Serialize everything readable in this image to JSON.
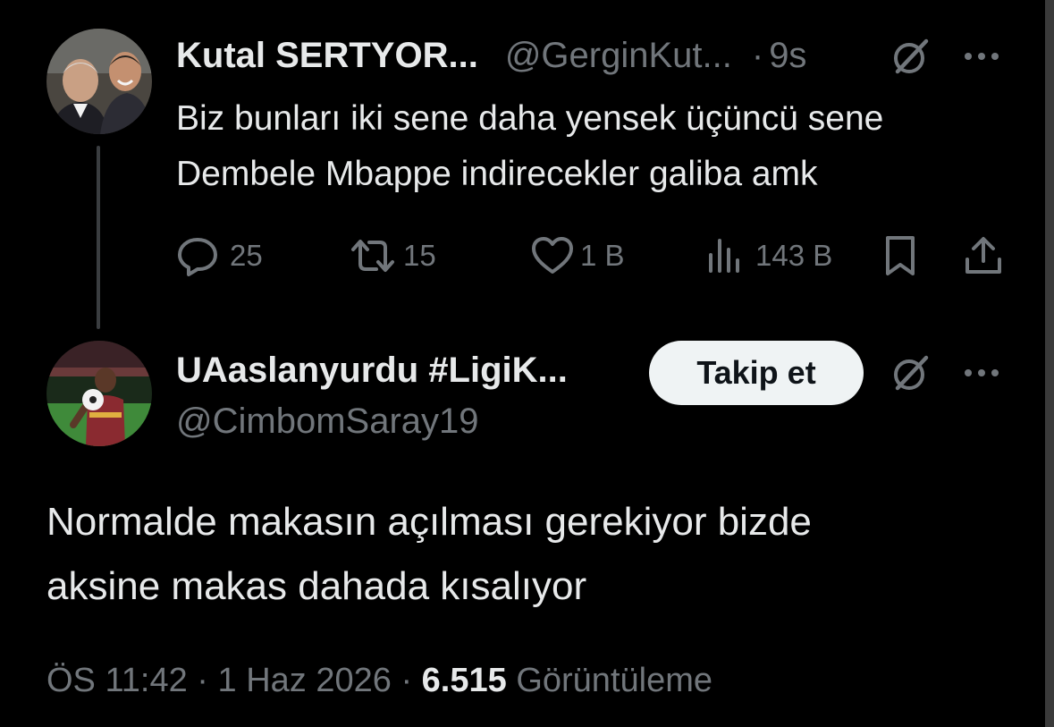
{
  "parent_tweet": {
    "author_name": "Kutal SERTYOR...",
    "handle": "@GerginKut...",
    "separator": "·",
    "time": "9s",
    "text_line1": "Biz bunları iki sene daha yensek üçüncü sene",
    "text_line2": "Dembele Mbappe indirecekler galiba amk",
    "actions": {
      "replies": "25",
      "retweets": "15",
      "likes": "1 B",
      "views": "143 B"
    }
  },
  "main_tweet": {
    "author_name": "UAaslanyurdu #LigiK...",
    "handle": "@CimbomSaray19",
    "follow_label": "Takip et",
    "text_line1": "Normalde makasın açılması gerekiyor bizde",
    "text_line2": "aksine makas dahada kısalıyor",
    "meta": {
      "time": "ÖS 11:42",
      "sep1": "·",
      "date": "1 Haz 2026",
      "sep2": "·",
      "views_count": "6.515",
      "views_label": "Görüntüleme"
    }
  },
  "icons": {
    "grok": "grok-icon",
    "more": "more-icon",
    "reply": "reply-icon",
    "retweet": "retweet-icon",
    "like": "heart-icon",
    "views": "views-icon",
    "bookmark": "bookmark-icon",
    "share": "share-icon"
  },
  "colors": {
    "background": "#000000",
    "primary_text": "#e7e9ea",
    "secondary_text": "#71767b",
    "follow_button_bg": "#eff3f4",
    "follow_button_text": "#0f1419"
  }
}
